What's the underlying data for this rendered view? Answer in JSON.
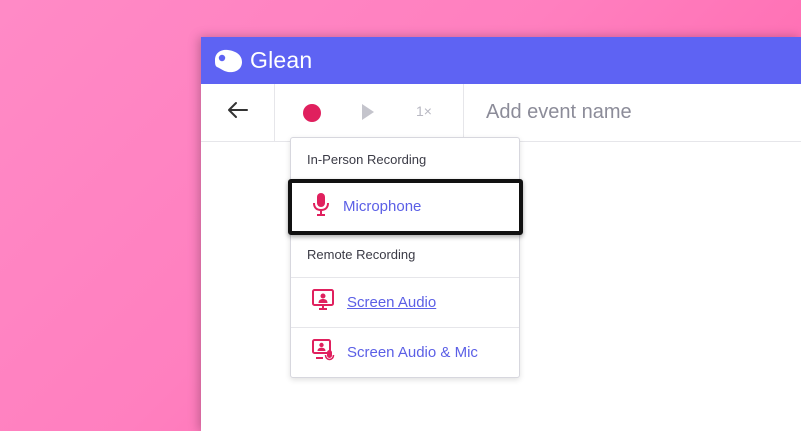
{
  "app": {
    "brand": "Glean"
  },
  "toolbar": {
    "speed_label": "1×",
    "event_placeholder": "Add event name"
  },
  "menu": {
    "in_person_title": "In-Person Recording",
    "remote_title": "Remote Recording",
    "items": [
      {
        "label": "Microphone",
        "icon": "microphone-icon"
      },
      {
        "label": "Screen Audio",
        "icon": "screen-audio-icon"
      },
      {
        "label": "Screen Audio & Mic",
        "icon": "screen-audio-mic-icon"
      }
    ]
  },
  "colors": {
    "accent": "#5e63f3",
    "record": "#e0205e",
    "link": "#5b5fe6"
  }
}
